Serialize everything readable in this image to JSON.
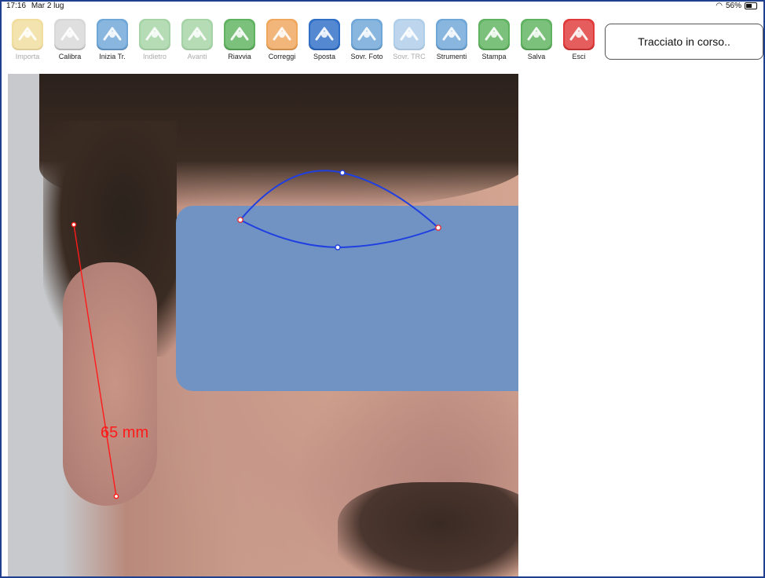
{
  "status_bar": {
    "time": "17:16",
    "date": "Mar 2 lug",
    "wifi_icon": "wifi-icon",
    "battery": "56%"
  },
  "toolbar": [
    {
      "label": "Importa",
      "icon": "import-icon",
      "enabled": false,
      "color": "#e7c24f"
    },
    {
      "label": "Calibra",
      "icon": "calibrate-icon",
      "enabled": true,
      "color": "#d8d8d8"
    },
    {
      "label": "Inizia Tr.",
      "icon": "start-trace-icon",
      "enabled": true,
      "color": "#6fa7d8"
    },
    {
      "label": "Indietro",
      "icon": "undo-icon",
      "enabled": false,
      "color": "#5fb25f"
    },
    {
      "label": "Avanti",
      "icon": "redo-icon",
      "enabled": false,
      "color": "#5fb25f"
    },
    {
      "label": "Riavvia",
      "icon": "restart-icon",
      "enabled": true,
      "color": "#5fb25f"
    },
    {
      "label": "Correggi",
      "icon": "correct-icon",
      "enabled": true,
      "color": "#f0a75d"
    },
    {
      "label": "Sposta",
      "icon": "move-icon",
      "enabled": true,
      "color": "#2f6fc7"
    },
    {
      "label": "Sovr. Foto",
      "icon": "overlay-photo-icon",
      "enabled": true,
      "color": "#6fa7d8"
    },
    {
      "label": "Sovr. TRC",
      "icon": "overlay-trc-icon",
      "enabled": false,
      "color": "#6fa7d8"
    },
    {
      "label": "Strumenti",
      "icon": "tools-icon",
      "enabled": true,
      "color": "#6fa7d8"
    },
    {
      "label": "Stampa",
      "icon": "print-icon",
      "enabled": true,
      "color": "#5fb25f"
    },
    {
      "label": "Salva",
      "icon": "save-icon",
      "enabled": true,
      "color": "#5fb25f"
    },
    {
      "label": "Esci",
      "icon": "exit-icon",
      "enabled": true,
      "color": "#e03a3a"
    }
  ],
  "status_box": {
    "text": "Tracciato in corso.."
  },
  "measurement": {
    "value_label": "65 mm"
  },
  "colors": {
    "trace_line": "#1f3fe0",
    "measure_line": "#ff1a1a",
    "panel": "#7193c3"
  }
}
